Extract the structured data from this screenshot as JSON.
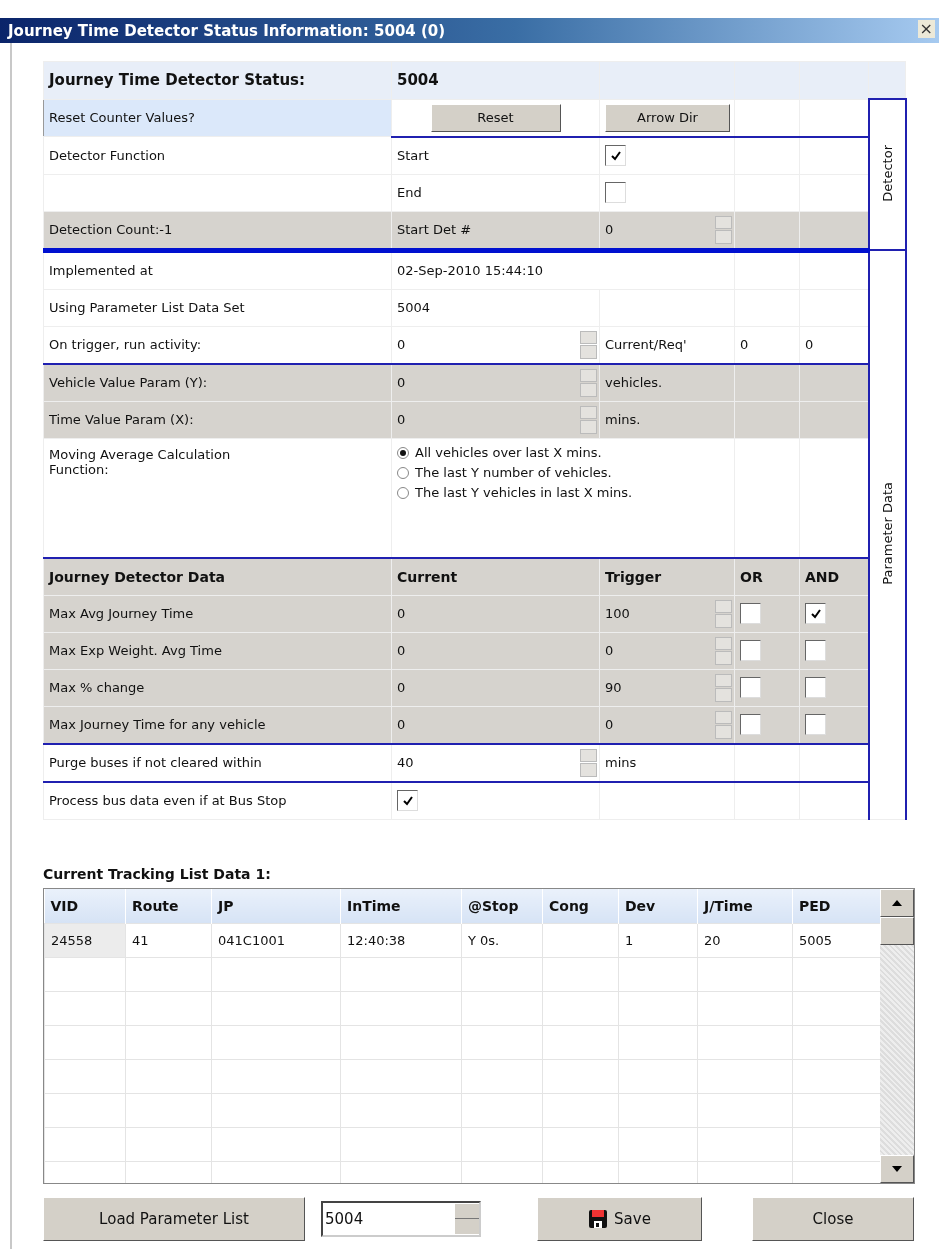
{
  "window": {
    "title": "Journey Time Detector Status Information: 5004 (0)",
    "close": "×"
  },
  "status": {
    "label": "Journey Time Detector Status:",
    "value": "5004"
  },
  "reset": {
    "label": "Reset Counter Values?",
    "buttons": [
      "Reset",
      "Arrow Dir"
    ]
  },
  "detector_function": {
    "label": "Detector Function",
    "options": [
      {
        "label": "Start",
        "checked": true
      },
      {
        "label": "End",
        "checked": false
      }
    ]
  },
  "detection_count": {
    "label": "Detection Count:-1",
    "field_label": "Start Det #",
    "value": "0"
  },
  "side_tabs": [
    {
      "label": "Detector",
      "selected": false
    },
    {
      "label": "Parameter Data",
      "selected": false
    }
  ],
  "implemented": {
    "label": "Implemented at",
    "value": "02-Sep-2010 15:44:10"
  },
  "parameter_set": {
    "label": "Using Parameter List Data Set",
    "value": "5004"
  },
  "trigger_activity": {
    "label": "On trigger, run activity:",
    "value": "0",
    "current_label": "Current/Req'",
    "current": "0",
    "required": "0"
  },
  "params": [
    {
      "label": "Vehicle Value Param (Y):",
      "value": "0",
      "unit": "vehicles."
    },
    {
      "label": "Time Value Param (X):",
      "value": "0",
      "unit": "mins."
    }
  ],
  "moving_average": {
    "label": "Moving Average Calculation Function:",
    "options": [
      {
        "label": "All vehicles over last X mins.",
        "selected": true
      },
      {
        "label": "The last Y number of vehicles.",
        "selected": false
      },
      {
        "label": "The last Y vehicles in last X mins.",
        "selected": false
      }
    ]
  },
  "detector_data": {
    "columns": [
      "Journey Detector Data",
      "Current",
      "Trigger",
      "OR",
      "AND"
    ],
    "rows": [
      {
        "label": "Max Avg Journey Time",
        "current": "0",
        "trigger": "100",
        "or": false,
        "and": true
      },
      {
        "label": "Max Exp Weight. Avg Time",
        "current": "0",
        "trigger": "0",
        "or": false,
        "and": false
      },
      {
        "label": "Max % change",
        "current": "0",
        "trigger": "90",
        "or": false,
        "and": false
      },
      {
        "label": "Max Journey Time for any vehicle",
        "current": "0",
        "trigger": "0",
        "or": false,
        "and": false
      }
    ]
  },
  "purge": {
    "label": "Purge buses if not cleared within",
    "value": "40",
    "unit": "mins"
  },
  "process_bus": {
    "label": "Process bus data even if at Bus Stop",
    "checked": true
  },
  "tracking": {
    "title": "Current Tracking List Data 1:",
    "columns": [
      "VID",
      "Route",
      "JP",
      "InTime",
      "@Stop",
      "Cong",
      "Dev",
      "J/Time",
      "PED"
    ],
    "rows": [
      [
        "24558",
        "41",
        "041C1001",
        "12:40:38",
        "Y 0s.",
        "",
        "1",
        "20",
        "5005"
      ]
    ]
  },
  "footer": {
    "load_button": "Load Parameter List",
    "parameter_list": "5004",
    "save_button": "Save",
    "close_button": "Close"
  }
}
